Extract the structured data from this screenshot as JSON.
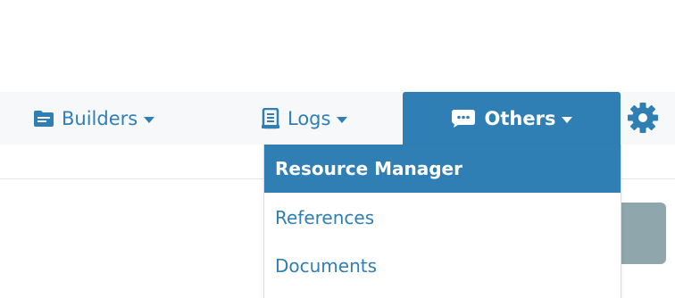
{
  "nav": {
    "builders": {
      "label": "Builders",
      "icon": "document-icon"
    },
    "logs": {
      "label": "Logs",
      "icon": "scroll-icon"
    },
    "others": {
      "label": "Others",
      "icon": "comment-dots-icon"
    },
    "settings": {
      "icon": "gear-icon"
    }
  },
  "dropdown": {
    "items": [
      {
        "label": "Resource Manager",
        "active": true
      },
      {
        "label": "References",
        "active": false
      },
      {
        "label": "Documents",
        "active": false
      }
    ]
  },
  "colors": {
    "accent": "#2f7fb5",
    "navbar_bg": "#f7f8fa",
    "muted_block": "#8fa6ad"
  }
}
